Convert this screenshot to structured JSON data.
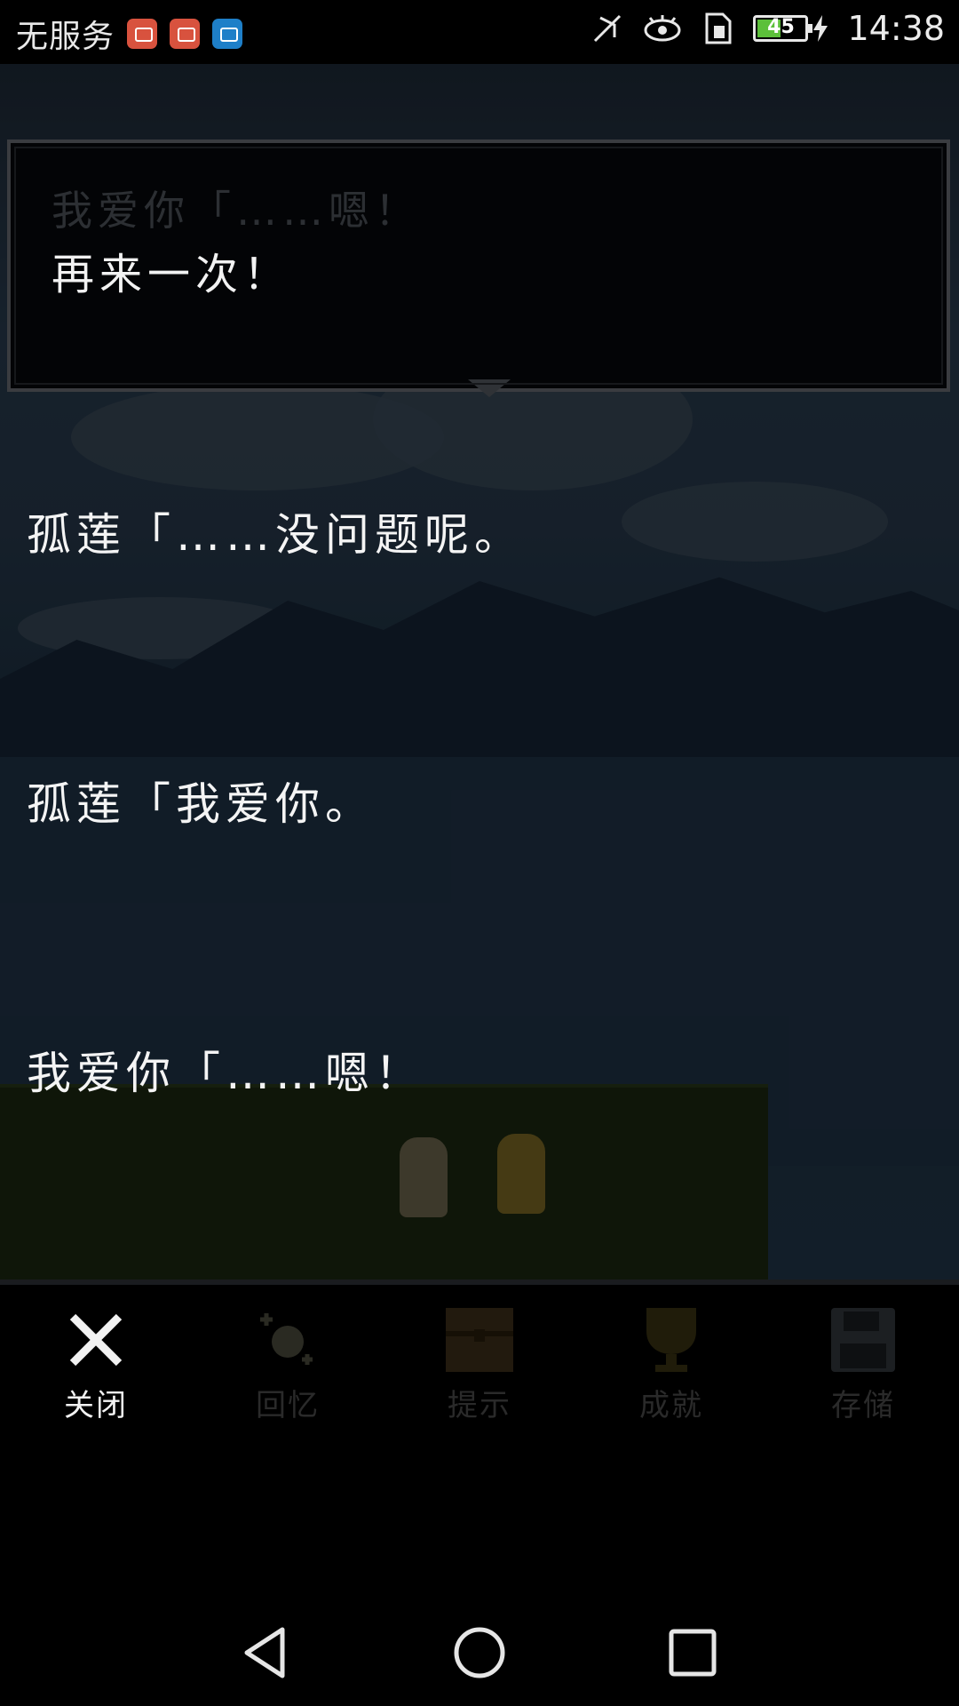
{
  "status_bar": {
    "carrier": "无服务",
    "battery_level": "45",
    "time": "14:38",
    "icons": [
      "email-app-icon",
      "tools-app-icon",
      "card-app-icon",
      "mute-icon",
      "eye-comfort-icon",
      "sim-icon",
      "battery-icon",
      "charging-icon"
    ]
  },
  "message_window": {
    "previous_line": "我爱你「……嗯！",
    "current_line": "再来一次！"
  },
  "backlog": [
    {
      "text": "孤莲「……没问题呢。"
    },
    {
      "text": "孤莲「我爱你。"
    },
    {
      "text": "我爱你「……嗯！"
    }
  ],
  "menu": {
    "items": [
      {
        "label": "关闭",
        "icon": "close-icon",
        "active": true
      },
      {
        "label": "回忆",
        "icon": "memory-icon",
        "active": false
      },
      {
        "label": "提示",
        "icon": "hint-chest-icon",
        "active": false
      },
      {
        "label": "成就",
        "icon": "trophy-icon",
        "active": false
      },
      {
        "label": "存储",
        "icon": "save-disk-icon",
        "active": false
      }
    ]
  },
  "navigation": {
    "buttons": [
      "back-icon",
      "home-icon",
      "recents-icon"
    ]
  }
}
